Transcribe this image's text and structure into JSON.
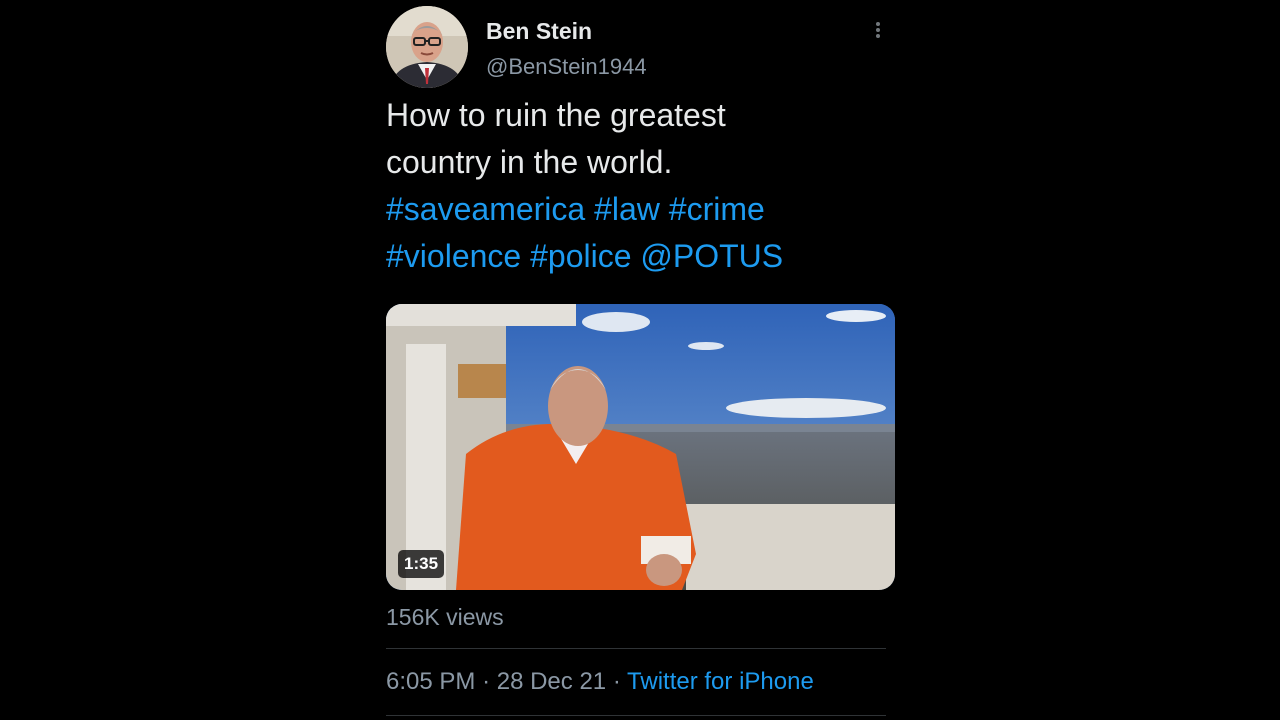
{
  "author": {
    "name": "Ben Stein",
    "handle": "@BenStein1944",
    "avatar_icon": "profile-photo"
  },
  "menu_icon": "more-vertical-icon",
  "tweet": {
    "text_lines": [
      "How to ruin the greatest",
      "country in the world."
    ],
    "hashtags_line1": [
      "#saveamerica",
      "#law",
      "#crime"
    ],
    "hashtags_line2": [
      "#violence",
      "#police"
    ],
    "mention": "@POTUS"
  },
  "media": {
    "type": "video",
    "duration": "1:35"
  },
  "stats": {
    "views": "156K views"
  },
  "meta": {
    "time": "6:05 PM",
    "separator": "·",
    "date": "28 Dec 21",
    "source": "Twitter for iPhone"
  },
  "colors": {
    "background": "#000000",
    "link": "#1d9bf0",
    "text": "#e7e9ea",
    "secondary": "#8b98a5"
  }
}
